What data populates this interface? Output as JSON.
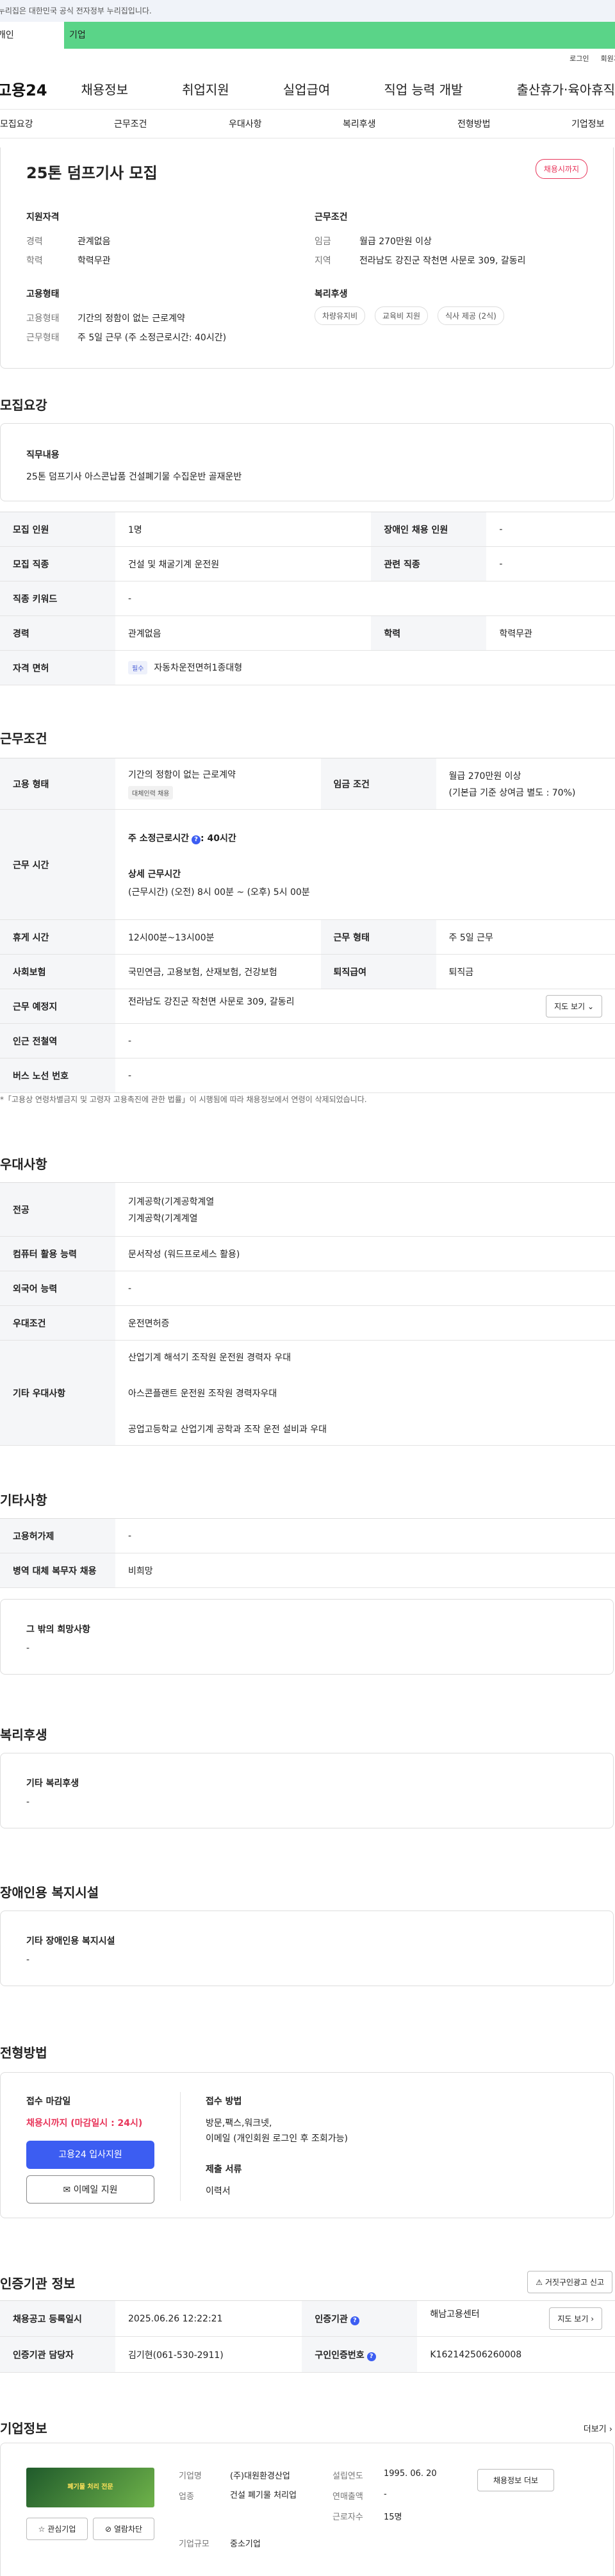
{
  "banner": {
    "text": "이 누리집은 대한민국 공식 전자정부 누리집입니다."
  },
  "category": {
    "tab1": "개인",
    "tab2": "기업"
  },
  "util": {
    "login": "로그인",
    "join": "회원가입"
  },
  "gnb": {
    "logo": "고용24",
    "menu": [
      "채용정보",
      "취업지원",
      "실업급여",
      "직업 능력 개발",
      "출산휴가·육아휴직"
    ]
  },
  "subnav": [
    "모집요강",
    "근무조건",
    "우대사항",
    "복리후생",
    "전형방법",
    "기업정보"
  ],
  "summary": {
    "title": "25톤 덤프기사 모집",
    "badge": "채용시까지",
    "qual_title": "지원자격",
    "qual": [
      {
        "k": "경력",
        "v": "관계없음"
      },
      {
        "k": "학력",
        "v": "학력무관"
      }
    ],
    "cond_title": "근무조건",
    "cond": [
      {
        "k": "임금",
        "v": "월급 270만원 이상"
      },
      {
        "k": "지역",
        "v": "전라남도 강진군 작천면 사문로 309, 갈동리"
      }
    ],
    "emp_title": "고용형태",
    "emp": [
      {
        "k": "고용형태",
        "v": "기간의 정함이 없는 근로계약"
      },
      {
        "k": "근무형태",
        "v": "주 5일 근무 (주 소정근로시간: 40시간)"
      }
    ],
    "welfare_title": "복리후생",
    "welfare_chips": [
      "차량유지비",
      "교육비 지원",
      "식사 제공 (2식)"
    ]
  },
  "recruit": {
    "heading": "모집요강",
    "job_title": "직무내용",
    "job_text": "25톤 덤프기사 아스콘납품 건설폐기물 수집운반 골재운반",
    "rows": [
      {
        "k1": "모집 인원",
        "v1": "1명",
        "k2": "장애인 채용 인원",
        "v2": "-"
      },
      {
        "k1": "모집 직종",
        "v1": "건설 및 채굴기계 운전원",
        "k2": "관련 직종",
        "v2": "-"
      },
      {
        "k1": "직종 키워드",
        "v1": "-"
      },
      {
        "k1": "경력",
        "v1": "관계없음",
        "k2": "학력",
        "v2": "학력무관"
      },
      {
        "k1": "자격 면허",
        "tag": "필수",
        "v1": "자동차운전면허1종대형"
      }
    ]
  },
  "work": {
    "heading": "근무조건",
    "emp_type_k": "고용 형태",
    "emp_type_v": "기간의 정함이 없는 근로계약",
    "emp_type_tag": "대체인력 채용",
    "wage_k": "임금 조건",
    "wage_v1": "월급 270만원 이상",
    "wage_v2": "(기본급 기준 상여금 별도 : 70%)",
    "hours_k": "근무 시간",
    "hours_main": "주 소정근로시간",
    "hours_main_v": ": 40시간",
    "hours_detail_title": "상세 근무시간",
    "hours_detail": "(근무시간) (오전) 8시 00분 ~ (오후) 5시 00분",
    "rows": [
      {
        "k1": "휴게 시간",
        "v1": "12시00분~13시00분",
        "k2": "근무 형태",
        "v2": "주 5일 근무"
      },
      {
        "k1": "사회보험",
        "v1": "국민연금, 고용보험, 산재보험, 건강보험",
        "k2": "퇴직급여",
        "v2": "퇴직금"
      }
    ],
    "location_k": "근무 예정지",
    "location_v": "전라남도 강진군 작천면 사문로 309, 갈동리",
    "map_btn": "지도 보기",
    "station_k": "인근 전철역",
    "station_v": "-",
    "bus_k": "버스 노선 번호",
    "bus_v": "-",
    "note": "*「고용상 연령차별금지 및 고령자 고용촉진에 관한 법률」이 시행됨에 따라 채용정보에서 연령이 삭제되었습니다."
  },
  "pref": {
    "heading": "우대사항",
    "major_k": "전공",
    "major_v": [
      "기계공학(기계공학계열",
      "기계공학(기계계열"
    ],
    "pc_k": "컴퓨터 활용 능력",
    "pc_v": "문서작성 (워드프로세스 활용)",
    "lang_k": "외국어 능력",
    "lang_v": "-",
    "cond_k": "우대조건",
    "cond_v": "운전면허증",
    "etc_k": "기타 우대사항",
    "etc_v": [
      "산업기계 해석기 조작원 운전원 경력자 우대",
      "아스콘플랜트 운전원 조작원 경력자우대",
      "공업고등학교 산업기계 공학과 조작 운전 설비과 우대"
    ]
  },
  "other": {
    "heading": "기타사항",
    "rows": [
      {
        "k": "고용허가제",
        "v": "-"
      },
      {
        "k": "병역 대체 복무자 채용",
        "v": "비희망"
      }
    ],
    "etc_title": "그 밖의 희망사항",
    "etc_v": "-"
  },
  "welfare": {
    "heading": "복리후생",
    "title": "기타 복리후생",
    "v": "-"
  },
  "disabled": {
    "heading": "장애인용 복지시설",
    "title": "기타 장애인용 복지시설",
    "v": "-"
  },
  "screen": {
    "heading": "전형방법",
    "deadline_title": "접수 마감일",
    "deadline_v": "채용시까지 (마감일시 : 24시)",
    "apply_btn": "고용24 입사지원",
    "email_btn": "이메일 지원",
    "method_title": "접수 방법",
    "method_v1": "방문,팩스,워크넷,",
    "method_v2": "이메일 (개인회원 로그인 후 조회가능)",
    "docs_title": "제출 서류",
    "docs_v": "이력서"
  },
  "agency": {
    "heading": "인증기관 정보",
    "report_btn": "거짓구인광고 신고",
    "rows": [
      {
        "k1": "채용공고 등록일시",
        "v1": "2025.06.26 12:22:21",
        "k2": "인증기관",
        "v2": "해남고용센터",
        "btn": "지도 보기"
      },
      {
        "k1": "인증기관 담당자",
        "v1": "김기현(061-530-2911)",
        "k2": "구인인증번호",
        "v2": "K162142506260008"
      }
    ]
  },
  "company": {
    "heading": "기업정보",
    "more": "더보기",
    "logo_text": "폐기물 처리 전문",
    "fav_btn": "관심기업",
    "block_btn": "열람차단",
    "info": [
      {
        "k": "기업명",
        "v": "(주)대원환경산업"
      },
      {
        "k": "업종",
        "v": "건설 폐기물 처리업"
      },
      {
        "k": "기업규모",
        "v": "중소기업"
      }
    ],
    "info2": [
      {
        "k": "설립연도",
        "v": "1995. 06. 20"
      },
      {
        "k": "연매출액",
        "v": "-"
      },
      {
        "k": "근로자수",
        "v": "15명"
      }
    ],
    "jobs_btn": "채용정보 더보"
  }
}
